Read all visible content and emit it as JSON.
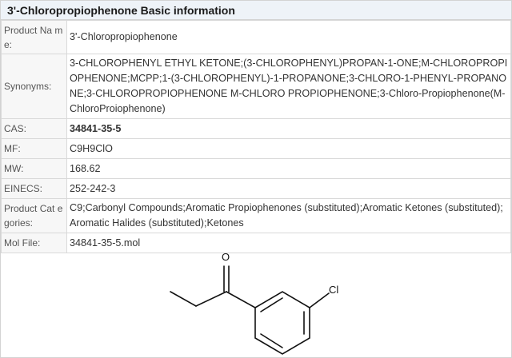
{
  "header": {
    "title": "3'-Chloropropiophenone Basic information"
  },
  "rows": {
    "product_name": {
      "label": "Product Na me:",
      "value": "3'-Chloropropiophenone"
    },
    "synonyms": {
      "label": "Synonyms:",
      "value": "3-CHLOROPHENYL ETHYL KETONE;(3-CHLOROPHENYL)PROPAN-1-ONE;M-CHLOROPROPIOPHENONE;MCPP;1-(3-CHLOROPHENYL)-1-PROPANONE;3-CHLORO-1-PHENYL-PROPANONE;3-CHLOROPROPIOPHENONE M-CHLORO PROPIOPHENONE;3-Chloro-Propiophenone(M-ChloroProiophenone)"
    },
    "cas": {
      "label": "CAS:",
      "value": "34841-35-5"
    },
    "mf": {
      "label": "MF:",
      "value": "C9H9ClO"
    },
    "mw": {
      "label": "MW:",
      "value": "168.62"
    },
    "einecs": {
      "label": "EINECS:",
      "value": "252-242-3"
    },
    "categories": {
      "label": "Product Cat egories:",
      "value": "C9;Carbonyl Compounds;Aromatic Propiophenones (substituted);Aromatic Ketones (substituted);Aromatic Halides (substituted);Ketones"
    },
    "mol_file": {
      "label": "Mol File:",
      "value": "34841-35-5.mol"
    }
  },
  "structure": {
    "atom_o": "O",
    "atom_cl": "Cl"
  },
  "colors": {
    "link": "#1f4fa3",
    "header_bg": "#eef3f8",
    "border": "#d9d9d9"
  }
}
